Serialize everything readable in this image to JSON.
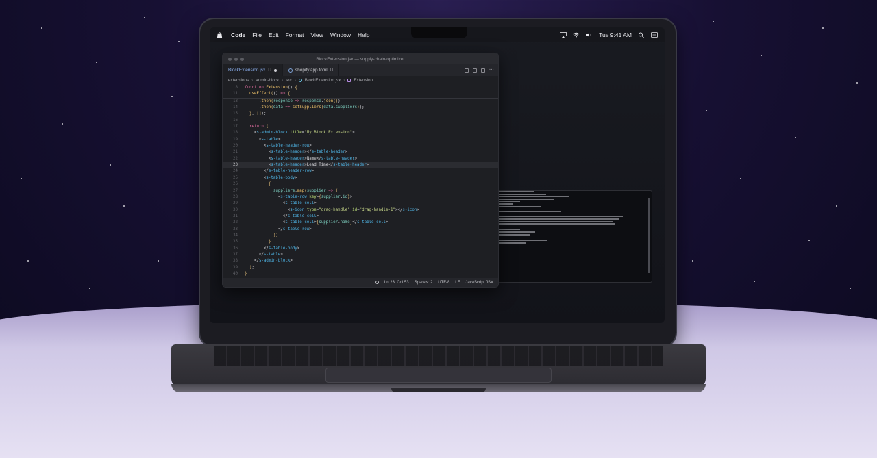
{
  "menubar": {
    "items": [
      "Code",
      "File",
      "Edit",
      "Format",
      "View",
      "Window",
      "Help"
    ],
    "clock": "Tue 9:41 AM"
  },
  "editor": {
    "window_title": "BlockExtension.jsx — supply-chain-optimizer",
    "tabs": [
      {
        "label": "BlockExtension.jsx",
        "suffix": "U"
      },
      {
        "label": "shopify.app.toml",
        "suffix": "U"
      }
    ],
    "breadcrumb": [
      "extensions",
      "admin-block",
      "src",
      "BlockExtension.jsx",
      "Extension"
    ],
    "status": {
      "position": "Ln 23, Col 53",
      "spaces": "Spaces: 2",
      "encoding": "UTF-8",
      "eol": "LF",
      "language": "JavaScript JSX"
    }
  },
  "code": {
    "sticky": [
      {
        "n": "8",
        "tokens": [
          [
            "kw",
            "function "
          ],
          [
            "fn2",
            "Extension"
          ],
          [
            "pl",
            "() "
          ],
          [
            "br",
            "{"
          ]
        ]
      },
      {
        "n": "11",
        "tokens": [
          [
            "pl",
            "  "
          ],
          [
            "fn2",
            "useEffect"
          ],
          [
            "br",
            "("
          ],
          [
            "pl",
            "() "
          ],
          [
            "kw",
            "=>"
          ],
          [
            "pl",
            " "
          ],
          [
            "br",
            "{"
          ]
        ]
      }
    ],
    "lines": [
      {
        "n": "13",
        "tokens": [
          [
            "pl",
            "      ."
          ],
          [
            "fn2",
            "then"
          ],
          [
            "br",
            "("
          ],
          [
            "var",
            "response"
          ],
          [
            "kw",
            " => "
          ],
          [
            "var",
            "response"
          ],
          [
            "pl",
            "."
          ],
          [
            "fn2",
            "json"
          ],
          [
            "br",
            "()"
          ],
          [
            "pl",
            ")"
          ]
        ]
      },
      {
        "n": "14",
        "tokens": [
          [
            "pl",
            "      ."
          ],
          [
            "fn2",
            "then"
          ],
          [
            "br",
            "("
          ],
          [
            "var",
            "data"
          ],
          [
            "kw",
            " => "
          ],
          [
            "fn2",
            "setSuppliers"
          ],
          [
            "br",
            "("
          ],
          [
            "var",
            "data"
          ],
          [
            "pl",
            "."
          ],
          [
            "var",
            "suppliers"
          ],
          [
            "br",
            ")"
          ],
          [
            "pl",
            ");"
          ]
        ]
      },
      {
        "n": "15",
        "tokens": [
          [
            "pl",
            "  "
          ],
          [
            "br",
            "}"
          ],
          [
            "pl",
            ", "
          ],
          [
            "br",
            "[]"
          ],
          [
            "pl",
            ");"
          ]
        ]
      },
      {
        "n": "16",
        "tokens": []
      },
      {
        "n": "17",
        "tokens": [
          [
            "kw",
            "  return "
          ],
          [
            "br",
            "("
          ]
        ]
      },
      {
        "n": "18",
        "tokens": [
          [
            "pl",
            "    <"
          ],
          [
            "tag",
            "s-admin-block"
          ],
          [
            "attr",
            " title"
          ],
          [
            "pl",
            "="
          ],
          [
            "str",
            "\"My Block Extension\""
          ],
          [
            "pl",
            ">"
          ]
        ]
      },
      {
        "n": "19",
        "tokens": [
          [
            "pl",
            "      <"
          ],
          [
            "tag",
            "s-table"
          ],
          [
            "pl",
            ">"
          ]
        ]
      },
      {
        "n": "20",
        "tokens": [
          [
            "pl",
            "        <"
          ],
          [
            "tag",
            "s-table-header-row"
          ],
          [
            "pl",
            ">"
          ]
        ]
      },
      {
        "n": "21",
        "tokens": [
          [
            "pl",
            "          <"
          ],
          [
            "tag",
            "s-table-header"
          ],
          [
            "pl",
            "></"
          ],
          [
            "tag",
            "s-table-header"
          ],
          [
            "pl",
            ">"
          ]
        ]
      },
      {
        "n": "22",
        "tokens": [
          [
            "pl",
            "          <"
          ],
          [
            "tag",
            "s-table-header"
          ],
          [
            "pl",
            ">Name</"
          ],
          [
            "tag",
            "s-table-header"
          ],
          [
            "pl",
            ">"
          ]
        ]
      },
      {
        "n": "23",
        "tokens": [
          [
            "pl",
            "          <"
          ],
          [
            "tag",
            "s-table-header"
          ],
          [
            "pl",
            ">Lead Time</"
          ],
          [
            "tag",
            "s-table-header"
          ],
          [
            "pl",
            ">"
          ]
        ],
        "highlight": true
      },
      {
        "n": "24",
        "tokens": [
          [
            "pl",
            "        </"
          ],
          [
            "tag",
            "s-table-header-row"
          ],
          [
            "pl",
            ">"
          ]
        ]
      },
      {
        "n": "25",
        "tokens": [
          [
            "pl",
            "        <"
          ],
          [
            "tag",
            "s-table-body"
          ],
          [
            "pl",
            ">"
          ]
        ]
      },
      {
        "n": "26",
        "tokens": [
          [
            "pl",
            "          "
          ],
          [
            "br",
            "{"
          ]
        ]
      },
      {
        "n": "27",
        "tokens": [
          [
            "pl",
            "            "
          ],
          [
            "var",
            "suppliers"
          ],
          [
            "pl",
            "."
          ],
          [
            "fn2",
            "map"
          ],
          [
            "br",
            "("
          ],
          [
            "var",
            "supplier"
          ],
          [
            "kw",
            " => "
          ],
          [
            "br",
            "("
          ]
        ]
      },
      {
        "n": "28",
        "tokens": [
          [
            "pl",
            "              <"
          ],
          [
            "tag",
            "s-table-row"
          ],
          [
            "attr",
            " key"
          ],
          [
            "pl",
            "="
          ],
          [
            "br",
            "{"
          ],
          [
            "var",
            "supplier"
          ],
          [
            "pl",
            "."
          ],
          [
            "var",
            "id"
          ],
          [
            "br",
            "}"
          ],
          [
            "pl",
            ">"
          ]
        ]
      },
      {
        "n": "29",
        "tokens": [
          [
            "pl",
            "                <"
          ],
          [
            "tag",
            "s-table-cell"
          ],
          [
            "pl",
            ">"
          ]
        ]
      },
      {
        "n": "30",
        "tokens": [
          [
            "pl",
            "                  <"
          ],
          [
            "tag",
            "s-icon"
          ],
          [
            "attr",
            " type"
          ],
          [
            "pl",
            "="
          ],
          [
            "str",
            "\"drag-handle\""
          ],
          [
            "attr",
            " id"
          ],
          [
            "pl",
            "="
          ],
          [
            "str",
            "\"drag-handle-1\""
          ],
          [
            "pl",
            "></"
          ],
          [
            "tag",
            "s-icon"
          ],
          [
            "pl",
            ">"
          ]
        ]
      },
      {
        "n": "31",
        "tokens": [
          [
            "pl",
            "                </"
          ],
          [
            "tag",
            "s-table-cell"
          ],
          [
            "pl",
            ">"
          ]
        ]
      },
      {
        "n": "32",
        "tokens": [
          [
            "pl",
            "                <"
          ],
          [
            "tag",
            "s-table-cell"
          ],
          [
            "pl",
            ">"
          ],
          [
            "br",
            "{"
          ],
          [
            "var",
            "supplier"
          ],
          [
            "pl",
            "."
          ],
          [
            "var",
            "name"
          ],
          [
            "br",
            "}"
          ],
          [
            "pl",
            "</"
          ],
          [
            "tag",
            "s-table-cell"
          ],
          [
            "pl",
            ">"
          ]
        ]
      },
      {
        "n": "33",
        "tokens": [
          [
            "pl",
            "              </"
          ],
          [
            "tag",
            "s-table-row"
          ],
          [
            "pl",
            ">"
          ]
        ]
      },
      {
        "n": "34",
        "tokens": [
          [
            "pl",
            "            "
          ],
          [
            "br",
            "))"
          ]
        ]
      },
      {
        "n": "35",
        "tokens": [
          [
            "pl",
            "          "
          ],
          [
            "br",
            "}"
          ]
        ]
      },
      {
        "n": "36",
        "tokens": [
          [
            "pl",
            "        </"
          ],
          [
            "tag",
            "s-table-body"
          ],
          [
            "pl",
            ">"
          ]
        ]
      },
      {
        "n": "37",
        "tokens": [
          [
            "pl",
            "      </"
          ],
          [
            "tag",
            "s-table"
          ],
          [
            "pl",
            ">"
          ]
        ]
      },
      {
        "n": "38",
        "tokens": [
          [
            "pl",
            "    </"
          ],
          [
            "tag",
            "s-admin-block"
          ],
          [
            "pl",
            ">"
          ]
        ]
      },
      {
        "n": "39",
        "tokens": [
          [
            "pl",
            "  "
          ],
          [
            "br",
            ")"
          ],
          [
            "pl",
            ";"
          ]
        ]
      },
      {
        "n": "40",
        "tokens": [
          [
            "br",
            "}"
          ]
        ]
      }
    ]
  },
  "colors": {
    "keyword": "#e06c9f",
    "function": "#f0c36b",
    "tag": "#4fb5e6",
    "attribute": "#c0e27a",
    "string": "#c9d98a",
    "variable": "#7fd3c3"
  }
}
